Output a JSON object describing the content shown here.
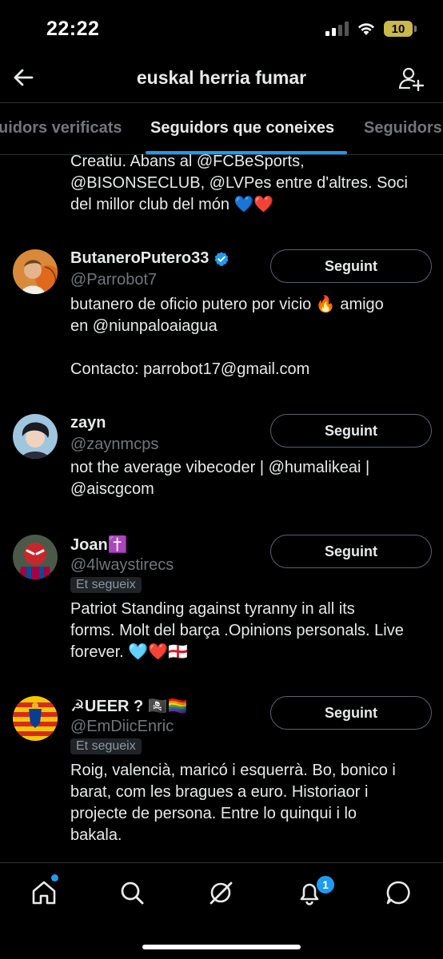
{
  "status": {
    "time": "22:22",
    "battery": "10"
  },
  "header": {
    "title": "euskal herria fumar"
  },
  "tabs": [
    {
      "label": "uidors verificats"
    },
    {
      "label": "Seguidors que coneixes"
    },
    {
      "label": "Seguidors"
    }
  ],
  "prev_bio": "Creatiu. Abans al @FCBeSports, @BISONSECLUB, @LVPes entre d'altres. Soci del millor club del món 💙❤️",
  "users": [
    {
      "name": "ButaneroPutero33",
      "handle": "@Parrobot7",
      "button": "Seguint",
      "bio_lines": [
        "butanero de oficio putero por vicio 🔥 amigo",
        "en @niunpaloaiagua",
        "",
        "Contacto: parrobot17@gmail.com"
      ]
    },
    {
      "name": "zayn",
      "handle": "@zaynmcps",
      "button": "Seguint",
      "bio_lines": [
        "not the average vibecoder | @humalikeai |",
        "@aiscgcom"
      ]
    },
    {
      "name": "Joan✝️",
      "handle": "@4lwaystirecs",
      "follows_you": "Et segueix",
      "button": "Seguint",
      "bio_lines": [
        "Patriot Standing against tyranny in all its",
        "forms. Molt del barça .Opinions personals. Live",
        "forever. 🩵❤️🏴󠁧󠁢󠁥󠁮󠁧󠁿"
      ]
    },
    {
      "name": "☭UEER ? 🏴‍☠️🏳️‍🌈",
      "handle": "@EmDiicEnric",
      "follows_you": "Et segueix",
      "button": "Seguint",
      "bio_lines": [
        "Roig, valencià, maricó i esquerrà. Bo, bonico i",
        "barat, com les bragues a euro. Historiaor i",
        "projecte de persona. Entre lo quinqui i lo",
        "bakala."
      ]
    }
  ],
  "nav": {
    "notifications_count": "1"
  },
  "colors": {
    "accent": "#1d9bf0",
    "background": "#000000",
    "muted": "#71767b"
  }
}
